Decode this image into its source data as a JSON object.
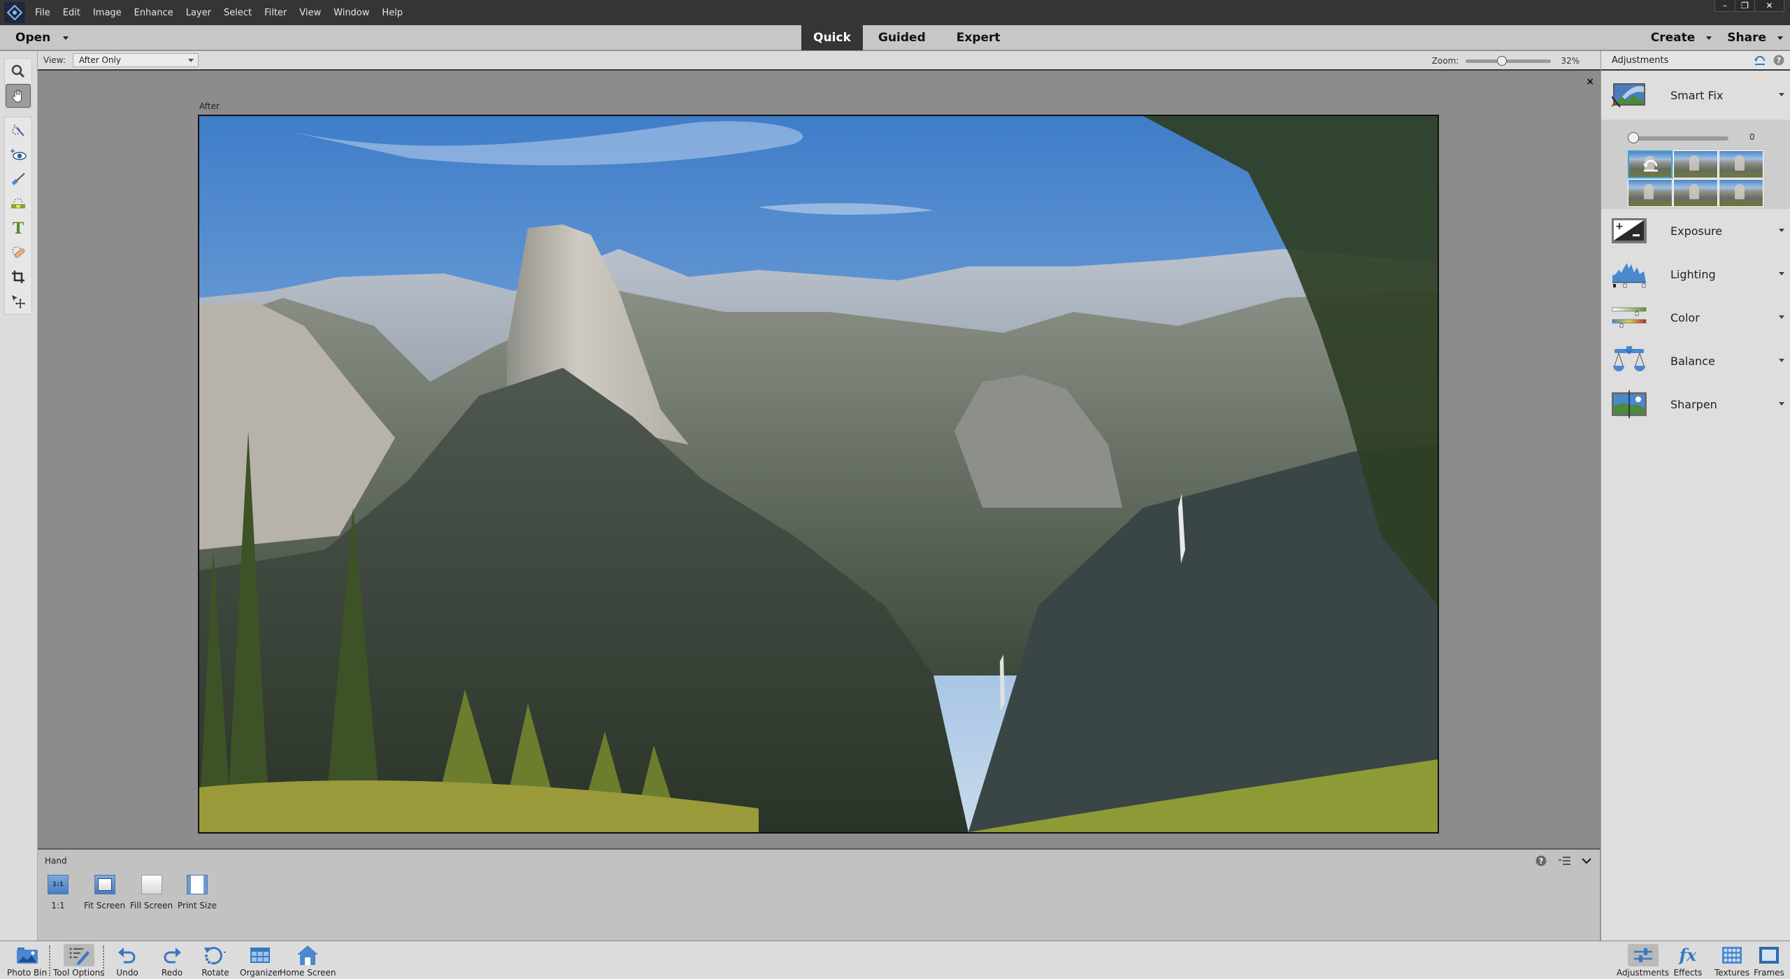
{
  "menubar": {
    "items": [
      "File",
      "Edit",
      "Image",
      "Enhance",
      "Layer",
      "Select",
      "Filter",
      "View",
      "Window",
      "Help"
    ],
    "window_controls": {
      "minimize": "–",
      "restore": "❐",
      "close": "✕"
    }
  },
  "topbar": {
    "open_label": "Open",
    "modes": [
      {
        "label": "Quick",
        "active": true
      },
      {
        "label": "Guided",
        "active": false
      },
      {
        "label": "Expert",
        "active": false
      }
    ],
    "create_label": "Create",
    "share_label": "Share"
  },
  "viewbar": {
    "view_label": "View:",
    "view_value": "After Only",
    "zoom_label": "Zoom:",
    "zoom_value": "32%",
    "zoom_percent": 32
  },
  "canvas": {
    "image_label": "After",
    "close_icon": "×"
  },
  "tools": [
    {
      "name": "zoom-tool",
      "icon": "magnifier"
    },
    {
      "name": "hand-tool",
      "icon": "hand",
      "selected": true
    },
    {
      "name": "quick-selection-tool",
      "icon": "quick-select"
    },
    {
      "name": "red-eye-tool",
      "icon": "eye"
    },
    {
      "name": "whiten-teeth-tool",
      "icon": "brush"
    },
    {
      "name": "straighten-tool",
      "icon": "level"
    },
    {
      "name": "type-tool",
      "icon": "T"
    },
    {
      "name": "spot-healing-tool",
      "icon": "bandage"
    },
    {
      "name": "crop-tool",
      "icon": "crop"
    },
    {
      "name": "move-tool",
      "icon": "move"
    }
  ],
  "tool_options": {
    "tool_name": "Hand",
    "buttons": [
      {
        "label": "1:1",
        "icon_text": "1:1"
      },
      {
        "label": "Fit Screen"
      },
      {
        "label": "Fill Screen"
      },
      {
        "label": "Print Size"
      }
    ]
  },
  "taskbar": {
    "left": [
      {
        "label": "Photo Bin",
        "icon": "photo-bin"
      },
      {
        "label": "Tool Options",
        "icon": "tool-options",
        "active": true
      },
      {
        "label": "Undo",
        "icon": "undo"
      },
      {
        "label": "Redo",
        "icon": "redo"
      },
      {
        "label": "Rotate",
        "icon": "rotate"
      },
      {
        "label": "Organizer",
        "icon": "organizer"
      },
      {
        "label": "Home Screen",
        "icon": "home"
      }
    ],
    "right": [
      {
        "label": "Adjustments",
        "icon": "adjustments",
        "active": true
      },
      {
        "label": "Effects",
        "icon": "fx"
      },
      {
        "label": "Textures",
        "icon": "textures"
      },
      {
        "label": "Frames",
        "icon": "frames"
      }
    ]
  },
  "adjustments": {
    "title": "Adjustments",
    "smart_fix": {
      "label": "Smart Fix",
      "value": "0",
      "value_fraction": 0
    },
    "items": [
      {
        "label": "Exposure"
      },
      {
        "label": "Lighting"
      },
      {
        "label": "Color"
      },
      {
        "label": "Balance"
      },
      {
        "label": "Sharpen"
      }
    ]
  },
  "colors": {
    "menubar_bg": "#353535",
    "active_tab_bg": "#353535",
    "accent_blue": "#3aa7d6",
    "panel_bg": "#dedede",
    "canvas_bg": "#8c8c8c"
  }
}
